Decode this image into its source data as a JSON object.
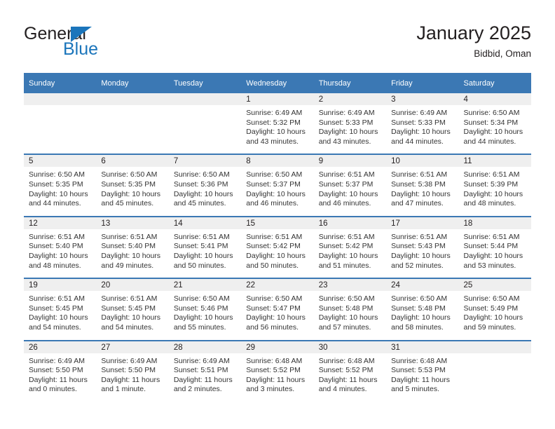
{
  "brand": {
    "name_part1": "General",
    "name_part2": "Blue",
    "flag_icon": "triangle-flag-icon"
  },
  "header": {
    "title": "January 2025",
    "location": "Bidbid, Oman"
  },
  "colors": {
    "header_blue": "#3b78b4",
    "brand_blue": "#1b75bb",
    "daynum_band": "#efefef",
    "text": "#231f20"
  },
  "calendar": {
    "weekday_headers": [
      "Sunday",
      "Monday",
      "Tuesday",
      "Wednesday",
      "Thursday",
      "Friday",
      "Saturday"
    ],
    "weeks": [
      [
        {
          "day": "",
          "empty": true,
          "lines": []
        },
        {
          "day": "",
          "empty": true,
          "lines": []
        },
        {
          "day": "",
          "empty": true,
          "lines": []
        },
        {
          "day": "1",
          "empty": false,
          "lines": [
            "Sunrise: 6:49 AM",
            "Sunset: 5:32 PM",
            "Daylight: 10 hours",
            "and 43 minutes."
          ]
        },
        {
          "day": "2",
          "empty": false,
          "lines": [
            "Sunrise: 6:49 AM",
            "Sunset: 5:33 PM",
            "Daylight: 10 hours",
            "and 43 minutes."
          ]
        },
        {
          "day": "3",
          "empty": false,
          "lines": [
            "Sunrise: 6:49 AM",
            "Sunset: 5:33 PM",
            "Daylight: 10 hours",
            "and 44 minutes."
          ]
        },
        {
          "day": "4",
          "empty": false,
          "lines": [
            "Sunrise: 6:50 AM",
            "Sunset: 5:34 PM",
            "Daylight: 10 hours",
            "and 44 minutes."
          ]
        }
      ],
      [
        {
          "day": "5",
          "empty": false,
          "lines": [
            "Sunrise: 6:50 AM",
            "Sunset: 5:35 PM",
            "Daylight: 10 hours",
            "and 44 minutes."
          ]
        },
        {
          "day": "6",
          "empty": false,
          "lines": [
            "Sunrise: 6:50 AM",
            "Sunset: 5:35 PM",
            "Daylight: 10 hours",
            "and 45 minutes."
          ]
        },
        {
          "day": "7",
          "empty": false,
          "lines": [
            "Sunrise: 6:50 AM",
            "Sunset: 5:36 PM",
            "Daylight: 10 hours",
            "and 45 minutes."
          ]
        },
        {
          "day": "8",
          "empty": false,
          "lines": [
            "Sunrise: 6:50 AM",
            "Sunset: 5:37 PM",
            "Daylight: 10 hours",
            "and 46 minutes."
          ]
        },
        {
          "day": "9",
          "empty": false,
          "lines": [
            "Sunrise: 6:51 AM",
            "Sunset: 5:37 PM",
            "Daylight: 10 hours",
            "and 46 minutes."
          ]
        },
        {
          "day": "10",
          "empty": false,
          "lines": [
            "Sunrise: 6:51 AM",
            "Sunset: 5:38 PM",
            "Daylight: 10 hours",
            "and 47 minutes."
          ]
        },
        {
          "day": "11",
          "empty": false,
          "lines": [
            "Sunrise: 6:51 AM",
            "Sunset: 5:39 PM",
            "Daylight: 10 hours",
            "and 48 minutes."
          ]
        }
      ],
      [
        {
          "day": "12",
          "empty": false,
          "lines": [
            "Sunrise: 6:51 AM",
            "Sunset: 5:40 PM",
            "Daylight: 10 hours",
            "and 48 minutes."
          ]
        },
        {
          "day": "13",
          "empty": false,
          "lines": [
            "Sunrise: 6:51 AM",
            "Sunset: 5:40 PM",
            "Daylight: 10 hours",
            "and 49 minutes."
          ]
        },
        {
          "day": "14",
          "empty": false,
          "lines": [
            "Sunrise: 6:51 AM",
            "Sunset: 5:41 PM",
            "Daylight: 10 hours",
            "and 50 minutes."
          ]
        },
        {
          "day": "15",
          "empty": false,
          "lines": [
            "Sunrise: 6:51 AM",
            "Sunset: 5:42 PM",
            "Daylight: 10 hours",
            "and 50 minutes."
          ]
        },
        {
          "day": "16",
          "empty": false,
          "lines": [
            "Sunrise: 6:51 AM",
            "Sunset: 5:42 PM",
            "Daylight: 10 hours",
            "and 51 minutes."
          ]
        },
        {
          "day": "17",
          "empty": false,
          "lines": [
            "Sunrise: 6:51 AM",
            "Sunset: 5:43 PM",
            "Daylight: 10 hours",
            "and 52 minutes."
          ]
        },
        {
          "day": "18",
          "empty": false,
          "lines": [
            "Sunrise: 6:51 AM",
            "Sunset: 5:44 PM",
            "Daylight: 10 hours",
            "and 53 minutes."
          ]
        }
      ],
      [
        {
          "day": "19",
          "empty": false,
          "lines": [
            "Sunrise: 6:51 AM",
            "Sunset: 5:45 PM",
            "Daylight: 10 hours",
            "and 54 minutes."
          ]
        },
        {
          "day": "20",
          "empty": false,
          "lines": [
            "Sunrise: 6:51 AM",
            "Sunset: 5:45 PM",
            "Daylight: 10 hours",
            "and 54 minutes."
          ]
        },
        {
          "day": "21",
          "empty": false,
          "lines": [
            "Sunrise: 6:50 AM",
            "Sunset: 5:46 PM",
            "Daylight: 10 hours",
            "and 55 minutes."
          ]
        },
        {
          "day": "22",
          "empty": false,
          "lines": [
            "Sunrise: 6:50 AM",
            "Sunset: 5:47 PM",
            "Daylight: 10 hours",
            "and 56 minutes."
          ]
        },
        {
          "day": "23",
          "empty": false,
          "lines": [
            "Sunrise: 6:50 AM",
            "Sunset: 5:48 PM",
            "Daylight: 10 hours",
            "and 57 minutes."
          ]
        },
        {
          "day": "24",
          "empty": false,
          "lines": [
            "Sunrise: 6:50 AM",
            "Sunset: 5:48 PM",
            "Daylight: 10 hours",
            "and 58 minutes."
          ]
        },
        {
          "day": "25",
          "empty": false,
          "lines": [
            "Sunrise: 6:50 AM",
            "Sunset: 5:49 PM",
            "Daylight: 10 hours",
            "and 59 minutes."
          ]
        }
      ],
      [
        {
          "day": "26",
          "empty": false,
          "lines": [
            "Sunrise: 6:49 AM",
            "Sunset: 5:50 PM",
            "Daylight: 11 hours",
            "and 0 minutes."
          ]
        },
        {
          "day": "27",
          "empty": false,
          "lines": [
            "Sunrise: 6:49 AM",
            "Sunset: 5:50 PM",
            "Daylight: 11 hours",
            "and 1 minute."
          ]
        },
        {
          "day": "28",
          "empty": false,
          "lines": [
            "Sunrise: 6:49 AM",
            "Sunset: 5:51 PM",
            "Daylight: 11 hours",
            "and 2 minutes."
          ]
        },
        {
          "day": "29",
          "empty": false,
          "lines": [
            "Sunrise: 6:48 AM",
            "Sunset: 5:52 PM",
            "Daylight: 11 hours",
            "and 3 minutes."
          ]
        },
        {
          "day": "30",
          "empty": false,
          "lines": [
            "Sunrise: 6:48 AM",
            "Sunset: 5:52 PM",
            "Daylight: 11 hours",
            "and 4 minutes."
          ]
        },
        {
          "day": "31",
          "empty": false,
          "lines": [
            "Sunrise: 6:48 AM",
            "Sunset: 5:53 PM",
            "Daylight: 11 hours",
            "and 5 minutes."
          ]
        },
        {
          "day": "",
          "empty": true,
          "lines": []
        }
      ]
    ]
  }
}
